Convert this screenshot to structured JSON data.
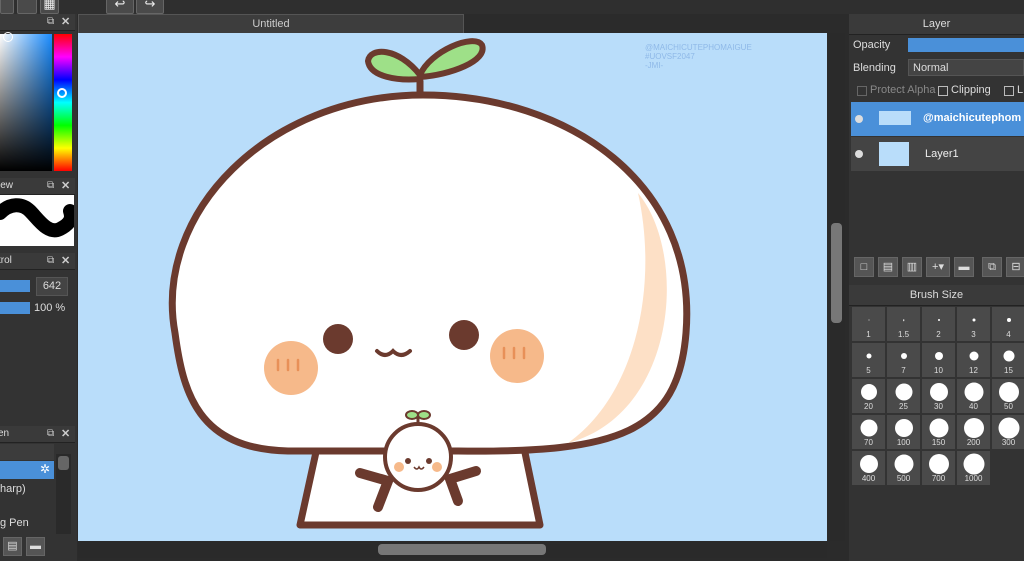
{
  "canvas": {
    "tab_title": "Untitled",
    "watermark_lines": [
      "@MAICHICUTEPHOMAIGUE",
      "#UOVSF2047",
      "-JMI-"
    ]
  },
  "left_panels": {
    "brush_preview_title": "iew",
    "control_title": "trol",
    "control_value1": "642",
    "control_value2": "100 %",
    "pen_panel_title": "en",
    "pen_items": [
      "harp)",
      "g Pen"
    ]
  },
  "layer_panel": {
    "title": "Layer",
    "opacity_label": "Opacity",
    "blending_label": "Blending",
    "blending_value": "Normal",
    "protect_alpha_label": "Protect Alpha",
    "clipping_label": "Clipping",
    "lock_label": "L",
    "layers": [
      {
        "name": "@maichicutephom",
        "selected": true
      },
      {
        "name": "Layer1",
        "selected": false
      }
    ]
  },
  "brush_size": {
    "title": "Brush Size",
    "sizes": [
      "1",
      "1.5",
      "2",
      "3",
      "4",
      "5",
      "7",
      "10",
      "12",
      "15",
      "20",
      "25",
      "30",
      "40",
      "50",
      "70",
      "100",
      "150",
      "200",
      "300",
      "400",
      "500",
      "700",
      "1000"
    ]
  },
  "colors": {
    "canvas_bg": "#b9ddfa",
    "accent": "#4a90d9",
    "leaf_green": "#9ee088",
    "outline_brown": "#6b3a2e",
    "blush": "#f6b98a"
  }
}
